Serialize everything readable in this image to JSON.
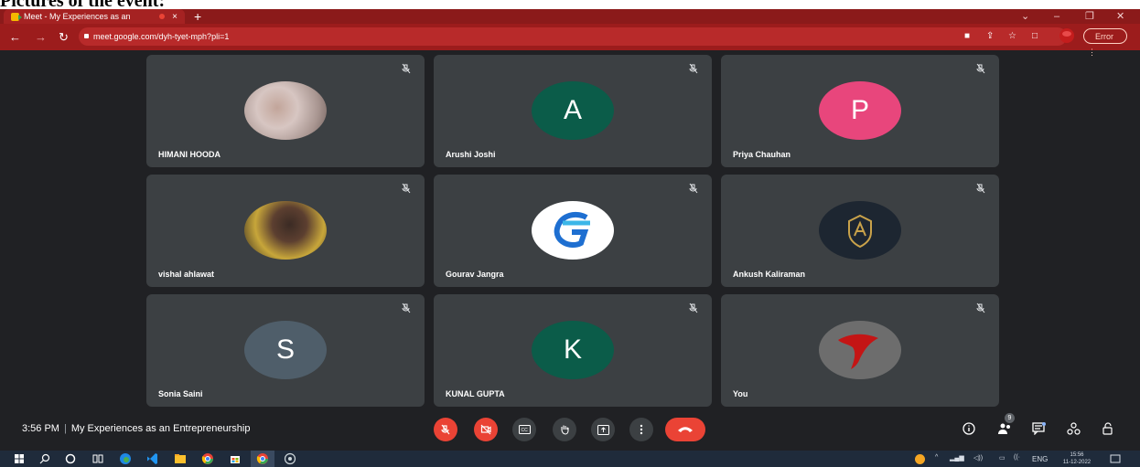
{
  "document": {
    "heading": "Pictures of the event:"
  },
  "browser": {
    "tab_title": "Meet - My Experiences as an",
    "tab_close": "×",
    "new_tab": "+",
    "url": "meet.google.com/dyh-tyet-mph?pli=1",
    "error_label": "Error",
    "window_controls": [
      "minimize-icon",
      "restore-icon",
      "close-icon"
    ],
    "colors": {
      "frame": "#8b1a1a",
      "toolbar": "#9c1c1c",
      "omnibox": "#b82a2a"
    }
  },
  "meeting": {
    "time": "3:56 PM",
    "separator": "|",
    "title": "My Experiences as an Entrepreneurship",
    "people_count": "9",
    "participants": [
      {
        "name": "HIMANI HOODA",
        "avatar": "photo",
        "muted": true
      },
      {
        "name": "Arushi Joshi",
        "avatar": "letter",
        "letter": "A",
        "color": "#0b5c49",
        "muted": true
      },
      {
        "name": "Priya Chauhan",
        "avatar": "letter",
        "letter": "P",
        "color": "#e8467c",
        "muted": true
      },
      {
        "name": "vishal ahlawat",
        "avatar": "photo",
        "muted": true
      },
      {
        "name": "Gourav Jangra",
        "avatar": "logo",
        "muted": true
      },
      {
        "name": "Ankush Kaliraman",
        "avatar": "logo",
        "muted": true
      },
      {
        "name": "Sonia Saini",
        "avatar": "letter",
        "letter": "S",
        "color": "#4f5e6a",
        "muted": true
      },
      {
        "name": "KUNAL GUPTA",
        "avatar": "letter",
        "letter": "K",
        "color": "#0b5c49",
        "muted": true
      },
      {
        "name": "You",
        "avatar": "logo",
        "muted": true
      }
    ],
    "controls": [
      "mic-off-icon",
      "camera-off-icon",
      "captions-icon",
      "raise-hand-icon",
      "present-icon",
      "more-options-icon",
      "end-call-icon"
    ],
    "right_controls": [
      "info-icon",
      "people-icon",
      "chat-icon",
      "activities-icon",
      "host-controls-icon"
    ],
    "accent_red": "#ea4335"
  },
  "taskbar": {
    "language": "ENG",
    "clock_time": "15:56",
    "clock_date": "11-12-2022",
    "icons": [
      "windows-start-icon",
      "search-icon",
      "cortana-icon",
      "task-view-icon",
      "edge-icon",
      "vscode-icon",
      "file-explorer-icon",
      "chrome-icon",
      "store-icon",
      "chrome-active-icon",
      "obs-icon"
    ]
  }
}
